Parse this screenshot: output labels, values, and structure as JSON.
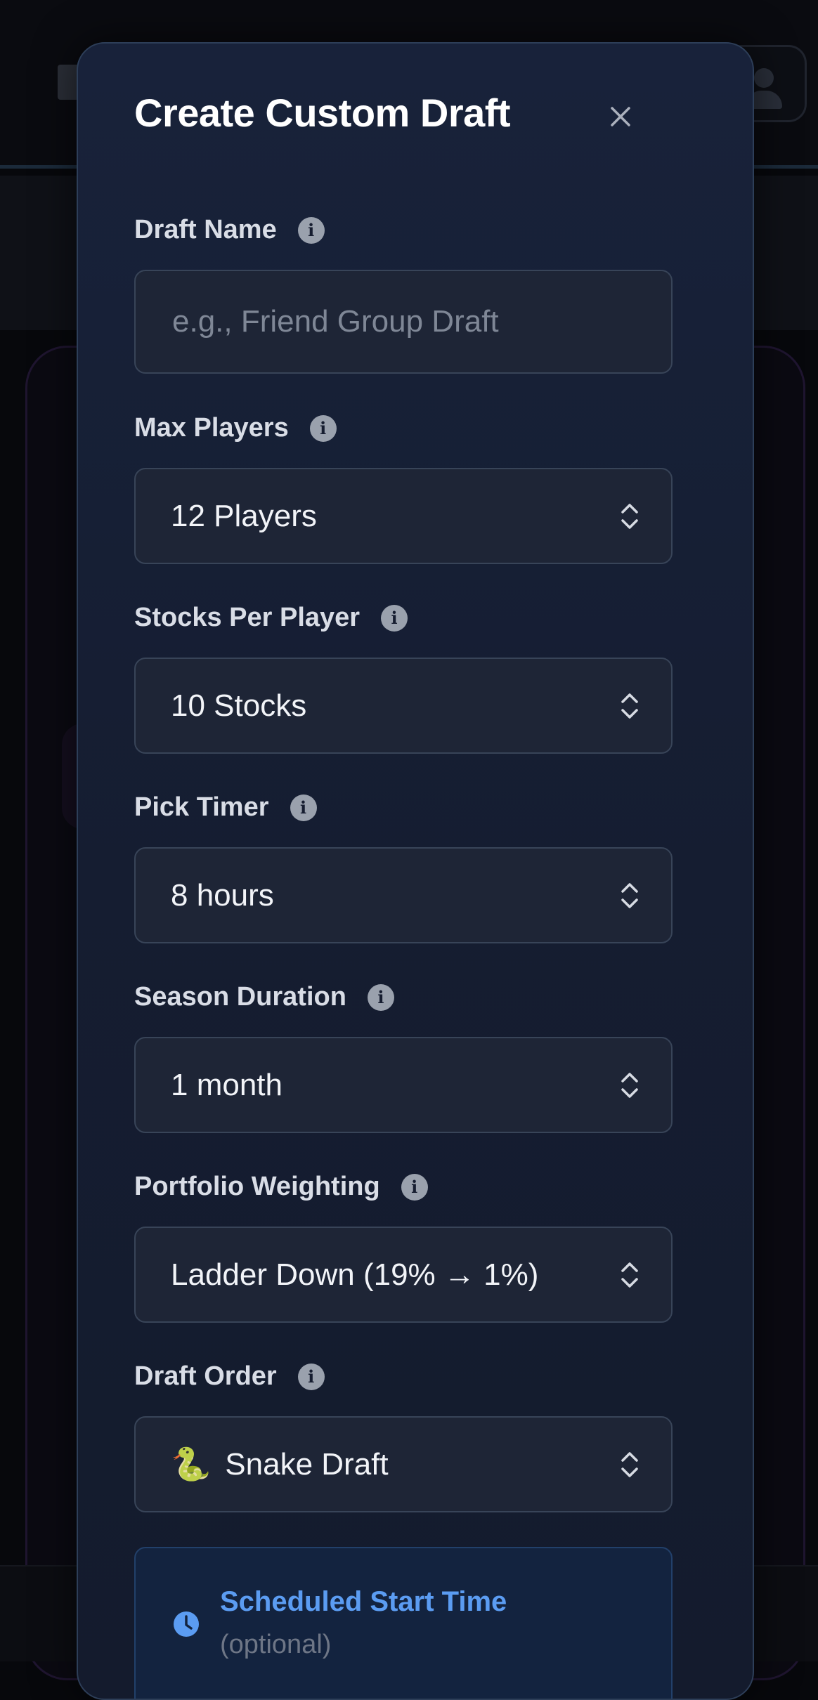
{
  "modal": {
    "title": "Create Custom Draft",
    "close_label": "×"
  },
  "fields": {
    "draft_name": {
      "label": "Draft Name",
      "placeholder": "e.g., Friend Group Draft",
      "value": ""
    },
    "max_players": {
      "label": "Max Players",
      "value": "12 Players"
    },
    "stocks_per_player": {
      "label": "Stocks Per Player",
      "value": "10 Stocks"
    },
    "pick_timer": {
      "label": "Pick Timer",
      "value": "8 hours"
    },
    "season_duration": {
      "label": "Season Duration",
      "value": "1 month"
    },
    "portfolio_weighting": {
      "label": "Portfolio Weighting",
      "value": "Ladder Down (19% → 1%)"
    },
    "draft_order": {
      "label": "Draft Order",
      "emoji": "🐍",
      "value": "Snake Draft"
    }
  },
  "schedule": {
    "title": "Scheduled Start Time",
    "subtitle": "(optional)"
  },
  "icons": {
    "info": "i",
    "close": "close-icon",
    "select": "chevron-up-down-icon",
    "clock": "clock-icon"
  },
  "colors": {
    "modal_bg": "#18223a",
    "input_bg": "#1e2536",
    "accent_blue": "#5b9cf2",
    "label": "#d9dde6"
  }
}
